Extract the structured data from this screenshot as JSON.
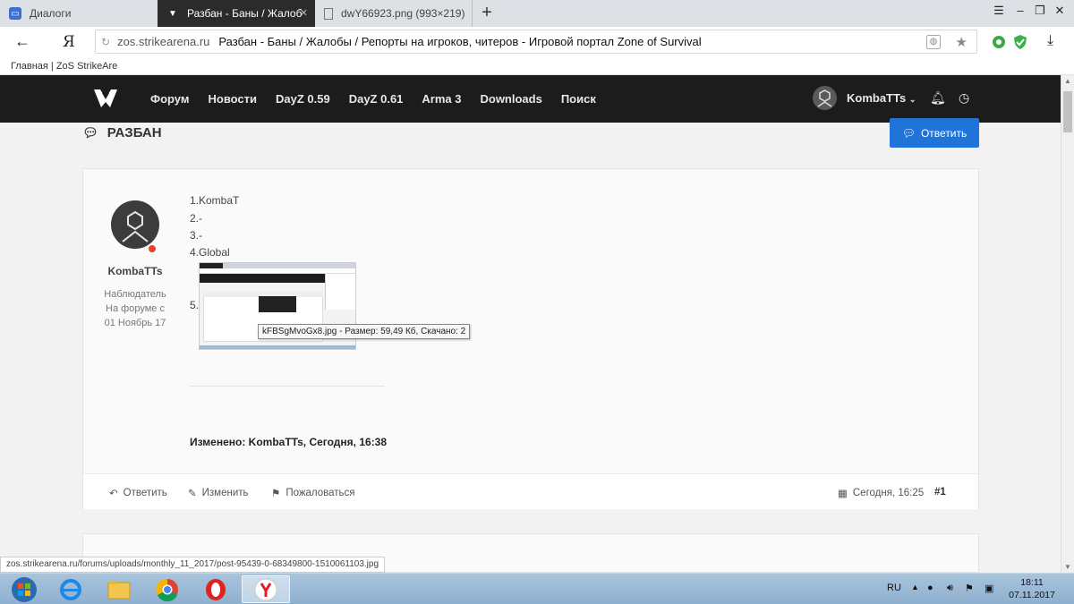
{
  "browser": {
    "tabs": [
      {
        "label": "Диалоги",
        "icon": "chat-icon"
      },
      {
        "label": "Разбан - Баны / Жалобы",
        "icon": "site-logo-icon",
        "active": true
      },
      {
        "label": "dwY66923.png (993×219)",
        "icon": "file-icon"
      }
    ],
    "address_host": "zos.strikearena.ru",
    "address_title": "Разбан - Баны / Жалобы / Репорты на игроков, читеров - Игровой портал Zone of Survival",
    "bookmark": "Главная | ZoS StrikeAre",
    "yandex_glyph": "Я"
  },
  "site": {
    "nav": [
      "Форум",
      "Новости",
      "DayZ 0.59",
      "DayZ 0.61",
      "Arma 3",
      "Downloads",
      "Поиск"
    ],
    "username": "KombaTTs",
    "page_title": "РАЗБАН",
    "reply_button": "Ответить"
  },
  "post": {
    "author": "KombaTTs",
    "role": "Наблюдатель",
    "since_label": "На форуме с",
    "since_date": "01 Ноябрь 17",
    "lines": [
      "1.KombaT",
      "2.-",
      "3.-",
      "4.Global",
      "5."
    ],
    "tooltip": "kFBSgMvoGx8.jpg - Размер: 59,49 Кб, Скачано: 2",
    "edited": "Изменено: KombaTTs, Сегодня, 16:38",
    "actions": {
      "reply": "Ответить",
      "edit": "Изменить",
      "report": "Пожаловаться"
    },
    "date": "Сегодня, 16:25",
    "number": "#1"
  },
  "status_url": "zos.strikearena.ru/forums/uploads/monthly_11_2017/post-95439-0-68349800-1510061103.jpg",
  "taskbar": {
    "lang": "RU",
    "time": "18:11",
    "date": "07.11.2017"
  }
}
